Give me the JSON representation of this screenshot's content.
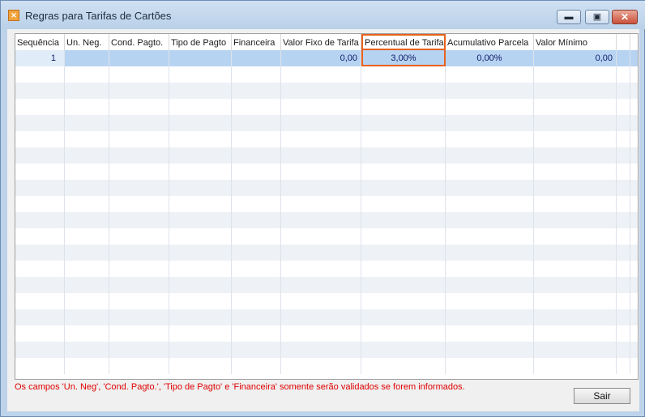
{
  "window": {
    "title": "Regras para Tarifas de Cartões"
  },
  "titlebar_buttons": {
    "minimize_icon": "minimize-icon",
    "maximize_icon": "maximize-icon",
    "close_icon": "close-icon"
  },
  "grid": {
    "columns": [
      "Sequência",
      "Un. Neg.",
      "Cond. Pagto.",
      "Tipo de Pagto",
      "Financeira",
      "Valor Fixo de Tarifa",
      "Percentual de Tarifa",
      "Acumulativo Parcela",
      "Valor Mínimo"
    ],
    "rows": [
      {
        "sequencia": "1",
        "un_neg": "",
        "cond_pagto": "",
        "tipo_pagto": "",
        "financeira": "",
        "valor_fixo": "0,00",
        "percentual": "3,00%",
        "acumulativo": "0,00%",
        "valor_minimo": "0,00"
      }
    ]
  },
  "note": "Os campos 'Un. Neg', 'Cond. Pagto.', 'Tipo de Pagto' e 'Financeira' somente serão validados se forem informados.",
  "buttons": {
    "sair_label": "Sair"
  },
  "colors": {
    "highlight": "#e8621c",
    "note": "#e00000",
    "selected_row": "#b7d3f2"
  }
}
